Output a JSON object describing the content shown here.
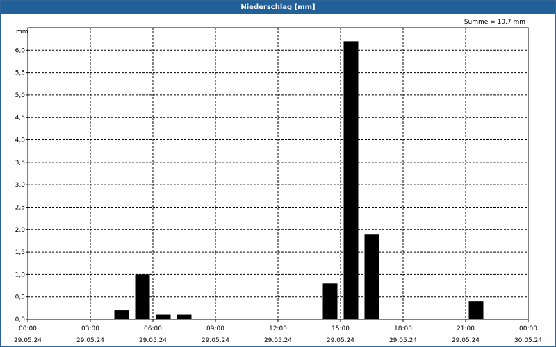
{
  "window": {
    "title": "Niederschlag [mm]"
  },
  "chart_data": {
    "type": "bar",
    "title": "Niederschlag [mm]",
    "ylabel": "mm",
    "ylim": [
      0,
      6.5
    ],
    "xlim": [
      "29.05.24 00:00",
      "30.05.24 00:00"
    ],
    "grid": true,
    "sum_label": "Summe = 10,7 mm",
    "y_ticks": [
      "0,0",
      "0,5",
      "1,0",
      "1,5",
      "2,0",
      "2,5",
      "3,0",
      "3,5",
      "4,0",
      "4,5",
      "5,0",
      "5,5",
      "6,0"
    ],
    "x_ticks": [
      {
        "time": "00:00",
        "date": "29.05.24"
      },
      {
        "time": "03:00",
        "date": "29.05.24"
      },
      {
        "time": "06:00",
        "date": "29.05.24"
      },
      {
        "time": "09:00",
        "date": "29.05.24"
      },
      {
        "time": "12:00",
        "date": "29.05.24"
      },
      {
        "time": "15:00",
        "date": "29.05.24"
      },
      {
        "time": "18:00",
        "date": "29.05.24"
      },
      {
        "time": "21:00",
        "date": "29.05.24"
      },
      {
        "time": "00:00",
        "date": "30.05.24"
      }
    ],
    "series": [
      {
        "bar_color": "#000000",
        "values": [
          {
            "start": "04:00",
            "end": "05:00",
            "value": 0.2
          },
          {
            "start": "05:00",
            "end": "06:00",
            "value": 1.0
          },
          {
            "start": "06:00",
            "end": "07:00",
            "value": 0.1
          },
          {
            "start": "07:00",
            "end": "08:00",
            "value": 0.1
          },
          {
            "start": "14:00",
            "end": "15:00",
            "value": 0.8
          },
          {
            "start": "15:00",
            "end": "16:00",
            "value": 6.2
          },
          {
            "start": "16:00",
            "end": "17:00",
            "value": 1.9
          },
          {
            "start": "21:00",
            "end": "22:00",
            "value": 0.4
          }
        ]
      }
    ]
  }
}
